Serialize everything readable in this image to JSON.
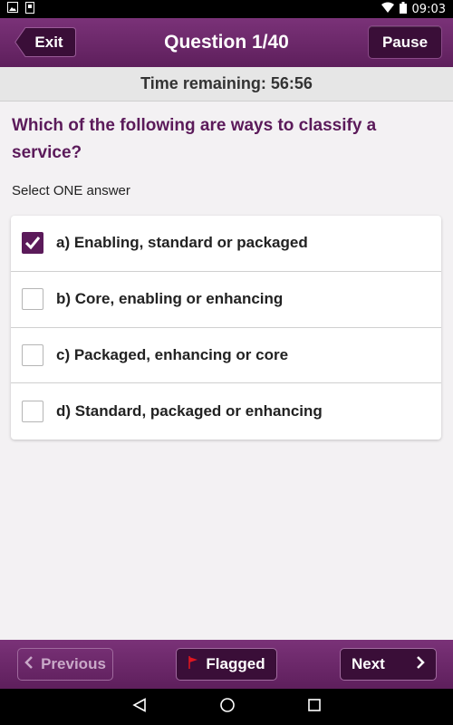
{
  "status": {
    "time": "09:03"
  },
  "header": {
    "exit_label": "Exit",
    "title": "Question 1/40",
    "pause_label": "Pause"
  },
  "timer": {
    "text": "Time remaining: 56:56"
  },
  "question": {
    "text": "Which of the following are ways to classify a service?",
    "instruction": "Select ONE answer"
  },
  "answers": [
    {
      "label": "a) Enabling, standard or packaged",
      "checked": true
    },
    {
      "label": "b) Core, enabling or enhancing",
      "checked": false
    },
    {
      "label": "c) Packaged, enhancing or core",
      "checked": false
    },
    {
      "label": "d) Standard, packaged or enhancing",
      "checked": false
    }
  ],
  "footer": {
    "previous_label": "Previous",
    "flagged_label": "Flagged",
    "next_label": "Next"
  },
  "colors": {
    "primary": "#5b1a5a",
    "flag": "#e0161f"
  }
}
